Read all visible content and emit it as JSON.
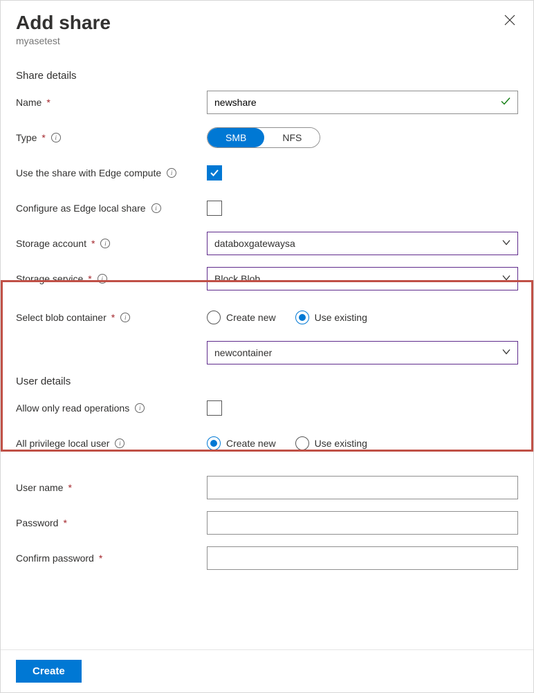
{
  "header": {
    "title": "Add share",
    "subtitle": "myasetest"
  },
  "sections": {
    "share_details": "Share details",
    "user_details": "User details"
  },
  "fields": {
    "name": {
      "label": "Name",
      "value": "newshare"
    },
    "type": {
      "label": "Type",
      "options": {
        "smb": "SMB",
        "nfs": "NFS"
      },
      "selected": "SMB"
    },
    "edge_compute": {
      "label": "Use the share with Edge compute",
      "checked": true
    },
    "local_share": {
      "label": "Configure as Edge local share",
      "checked": false
    },
    "storage_account": {
      "label": "Storage account",
      "value": "databoxgatewaysa"
    },
    "storage_service": {
      "label": "Storage service",
      "value": "Block Blob"
    },
    "blob_container": {
      "label": "Select blob container",
      "radio": {
        "create": "Create new",
        "existing": "Use existing",
        "selected": "Use existing"
      },
      "value": "newcontainer"
    },
    "read_only": {
      "label": "Allow only read operations",
      "checked": false
    },
    "privilege_user": {
      "label": "All privilege local user",
      "radio": {
        "create": "Create new",
        "existing": "Use existing",
        "selected": "Create new"
      }
    },
    "username": {
      "label": "User name",
      "value": ""
    },
    "password": {
      "label": "Password",
      "value": ""
    },
    "confirm_password": {
      "label": "Confirm password",
      "value": ""
    }
  },
  "footer": {
    "create": "Create"
  }
}
